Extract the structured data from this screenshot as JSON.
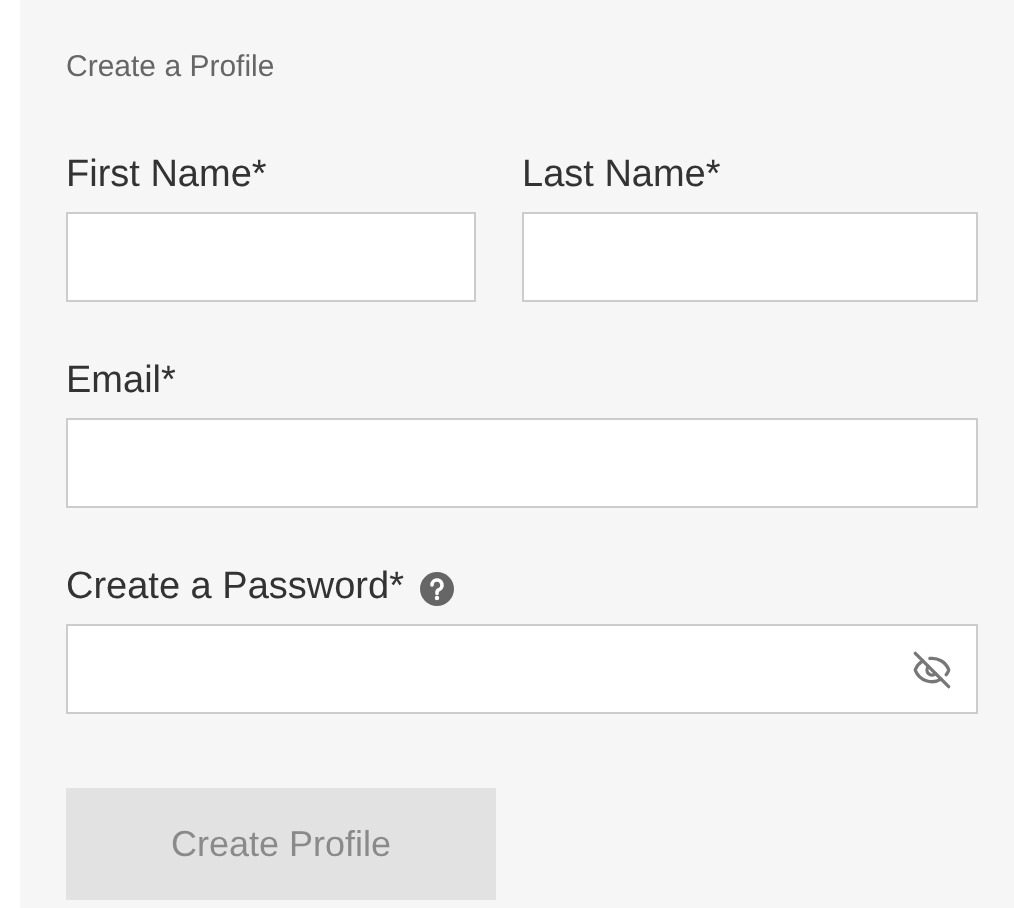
{
  "form": {
    "title": "Create a Profile",
    "name_fields": [
      {
        "label": "First Name*"
      },
      {
        "label": "Last Name*"
      }
    ],
    "email_field": {
      "label": "Email*"
    },
    "password_field": {
      "label": "Create a Password*",
      "help": true,
      "visible": false
    },
    "submit_button": {
      "label": "Create Profile",
      "disabled": true
    }
  }
}
